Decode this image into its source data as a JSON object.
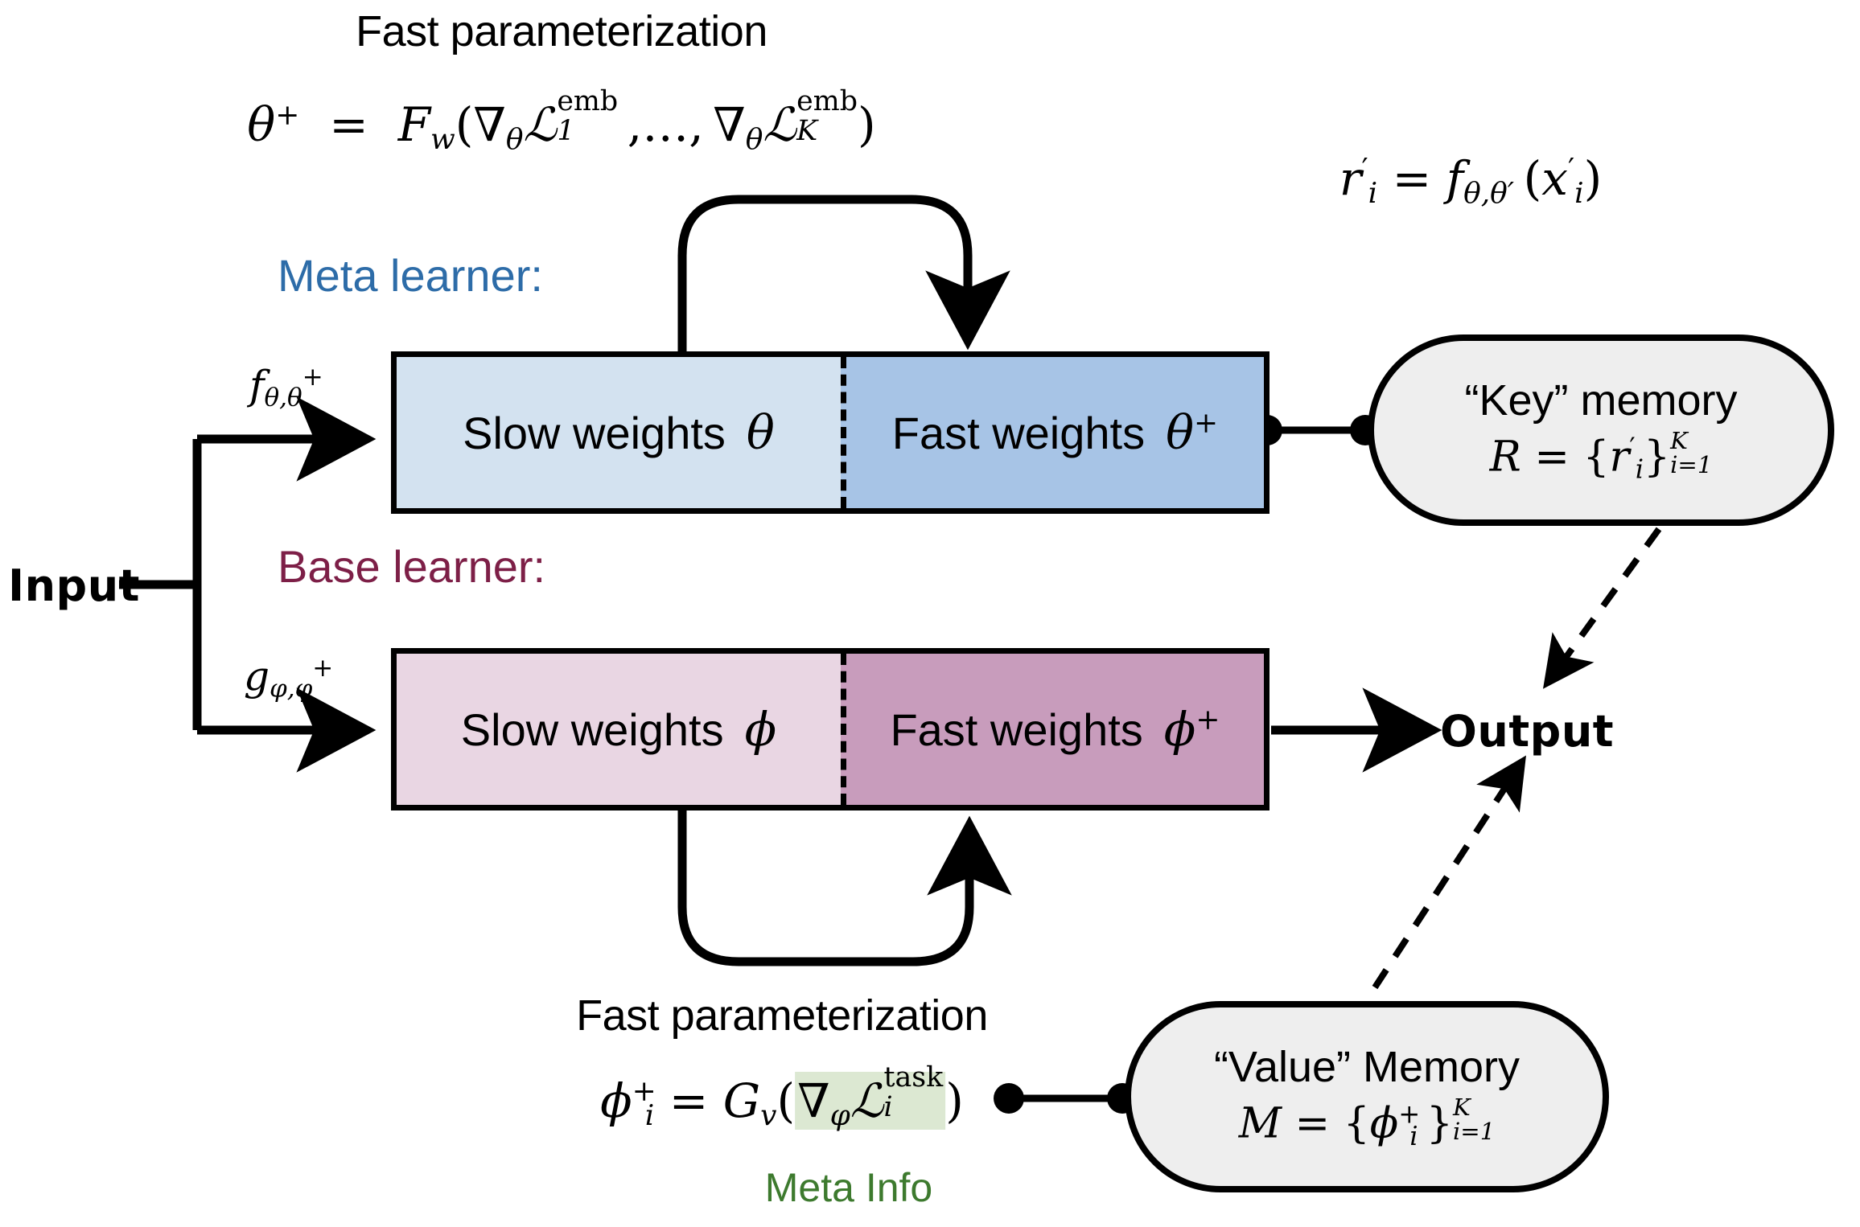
{
  "diagram": {
    "title_top": "Fast parameterization",
    "title_bottom": "Fast parameterization",
    "meta_learner_label": "Meta learner:",
    "base_learner_label": "Base learner:",
    "input_label": "Input",
    "output_label": "Output",
    "meta_info_label": "Meta Info",
    "colors": {
      "meta_learner": "#2d6ca8",
      "base_learner": "#7d1f47",
      "meta_info": "#3d7a2e",
      "meta_info_highlight": "#dce8d2",
      "slow_weights_theta_fill": "#d3e2f0",
      "fast_weights_theta_fill": "#a7c4e6",
      "slow_weights_phi_fill": "#e9d6e3",
      "fast_weights_phi_fill": "#c89cbc",
      "memory_fill": "#eeeeee",
      "stroke": "#000000"
    },
    "meta_row": {
      "function_label": "f",
      "function_sub": "θ,θ",
      "function_sup": "+",
      "slow": {
        "text": "Slow weights",
        "symbol": "θ"
      },
      "fast": {
        "text": "Fast weights",
        "symbol": "θ",
        "symbol_sup": "+"
      }
    },
    "base_row": {
      "function_label": "g",
      "function_sub": "φ,φ",
      "function_sup": "+",
      "slow": {
        "text": "Slow weights",
        "symbol": "φ"
      },
      "fast": {
        "text": "Fast weights",
        "symbol": "φ",
        "symbol_sup": "+"
      }
    },
    "equations": {
      "theta_plus": {
        "lhs_sym": "θ",
        "lhs_sup": "+",
        "eq": "=",
        "fn": "F",
        "fn_sub": "w",
        "open": "(",
        "grad": "∇",
        "grad_sub": "θ",
        "loss": "L",
        "loss_sup": "emb",
        "loss_sub1": "1",
        "dots": ",…,",
        "loss_sub2": "K",
        "close": ")"
      },
      "r_prime": {
        "lhs": "r",
        "lhs_prime": "′",
        "lhs_sub": "i",
        "eq": "=",
        "fn": "f",
        "fn_sub": "θ,θ′",
        "open": "(",
        "arg": "x",
        "arg_prime": "′",
        "arg_sub": "i",
        "close": ")"
      },
      "phi_plus": {
        "lhs_sym": "φ",
        "lhs_sup": "+",
        "lhs_sub": "i",
        "eq": "=",
        "fn": "G",
        "fn_sub": "v",
        "open": "(",
        "grad": "∇",
        "grad_sub": "φ",
        "loss": "L",
        "loss_sup": "task",
        "loss_sub": "i",
        "close": ")"
      }
    },
    "key_memory": {
      "title": "“Key” memory",
      "eq_lhs": "R",
      "eq": "=",
      "open": "{",
      "elem": "r",
      "elem_prime": "′",
      "elem_sub": "i",
      "close": "}",
      "sup": "K",
      "sub": "i=1"
    },
    "value_memory": {
      "title": "“Value” Memory",
      "eq_lhs": "M",
      "eq": "=",
      "open": "{",
      "elem": "φ",
      "elem_sup": "+",
      "elem_sub": "i",
      "close": "}",
      "sup": "K",
      "sub": "i=1"
    }
  }
}
